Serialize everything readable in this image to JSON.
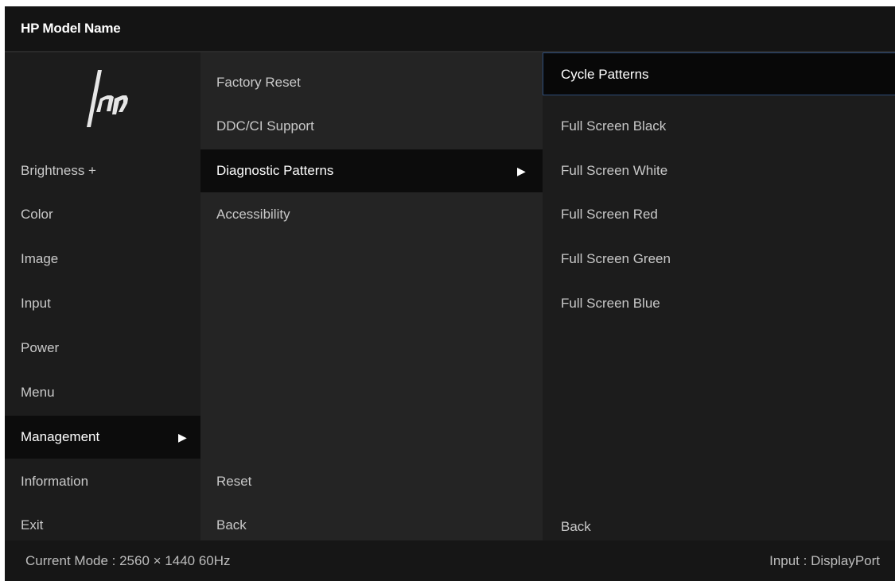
{
  "title": "HP Model Name",
  "logo": {
    "icon": "hp-logo-icon"
  },
  "main_menu": {
    "items": [
      {
        "label": "Brightness +"
      },
      {
        "label": "Color"
      },
      {
        "label": "Image"
      },
      {
        "label": "Input"
      },
      {
        "label": "Power"
      },
      {
        "label": "Menu"
      },
      {
        "label": "Management",
        "selected": true
      },
      {
        "label": "Information"
      },
      {
        "label": "Exit"
      }
    ]
  },
  "management_menu": {
    "items": [
      {
        "label": "Factory Reset"
      },
      {
        "label": "DDC/CI Support"
      },
      {
        "label": "Diagnostic Patterns",
        "selected": true
      },
      {
        "label": "Accessibility"
      }
    ],
    "reset_label": "Reset",
    "back_label": "Back"
  },
  "patterns_menu": {
    "items": [
      {
        "label": "Cycle Patterns",
        "focused": true
      },
      {
        "label": "Full Screen Black"
      },
      {
        "label": "Full Screen White"
      },
      {
        "label": "Full Screen Red"
      },
      {
        "label": "Full Screen Green"
      },
      {
        "label": "Full Screen Blue"
      }
    ],
    "back_label": "Back"
  },
  "arrow_glyph": "▶",
  "status": {
    "current_mode": "Current Mode : 2560 × 1440  60Hz",
    "input": "Input : DisplayPort"
  },
  "colors": {
    "panel_background": "#1e1e1e",
    "selected_background": "#0c0c0c",
    "text": "#c9c9c9",
    "highlight_text": "#ffffff",
    "focus_border": "#2d4d7a"
  }
}
